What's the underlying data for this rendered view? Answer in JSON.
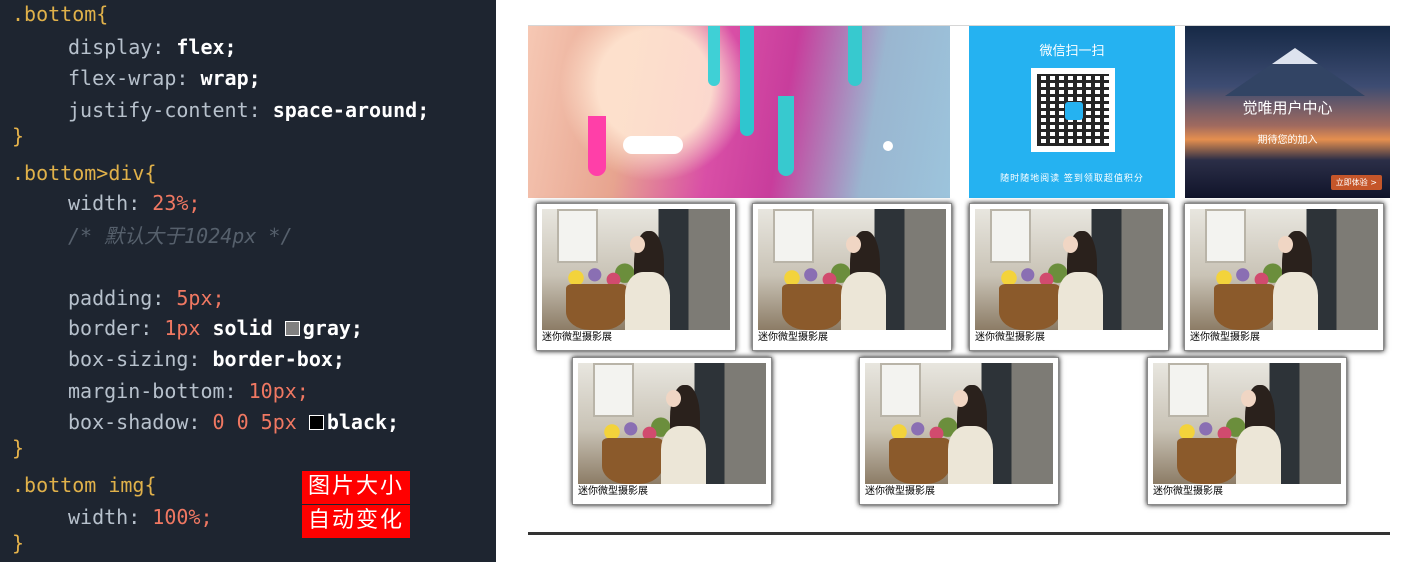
{
  "editor": {
    "lines": [
      ".bottom{",
      "display: flex;",
      "flex-wrap: wrap;",
      "justify-content: space-around;",
      "}",
      ".bottom>div{",
      "width: 23%;",
      "/* 默认大于1024px */",
      "",
      "padding: 5px;",
      "border: 1px solid ",
      "gray;",
      "box-sizing: border-box;",
      "margin-bottom: 10px;",
      "box-shadow: 0 0 5px ",
      "black;",
      "}",
      ".bottom img{",
      "width: 100%;",
      "}"
    ],
    "tokens": {
      "bottom_sel": ".bottom{",
      "display_prop": "display: ",
      "display_val": "flex;",
      "wrap_prop": "flex-wrap: ",
      "wrap_val": "wrap;",
      "justify_prop": "justify-content: ",
      "justify_val": "space-around;",
      "close": "}",
      "div_sel": ".bottom>div{",
      "width_prop": "width: ",
      "width_val": "23%;",
      "comment": "/* 默认大于1024px */",
      "padding_prop": "padding: ",
      "padding_val": "5px;",
      "border_prop": "border: ",
      "border_num": "1px",
      "border_kw": " solid ",
      "border_color": "gray;",
      "boxsizing_prop": "box-sizing: ",
      "boxsizing_val": "border-box;",
      "margin_prop": "margin-bottom: ",
      "margin_val": "10px;",
      "shadow_prop": "box-shadow: ",
      "shadow_nums": "0 0 5px",
      "shadow_color": "black;",
      "img_sel": ".bottom img{",
      "img_width_prop": "width: ",
      "img_width_val": "100%;"
    },
    "swatch_gray": "#808080",
    "swatch_black": "#000000"
  },
  "annotation": {
    "line1": "图片大小",
    "line2": "自动变化"
  },
  "preview": {
    "qr_panel": {
      "title": "微信扫一扫",
      "footer": "随时随地阅读  签到领取超值积分"
    },
    "user_panel": {
      "title": "觉唯用户中心",
      "subtitle": "期待您的加入",
      "button": "立即体验 >"
    },
    "cards": [
      {
        "caption": "迷你微型摄影展"
      },
      {
        "caption": "迷你微型摄影展"
      },
      {
        "caption": "迷你微型摄影展"
      },
      {
        "caption": "迷你微型摄影展"
      },
      {
        "caption": "迷你微型摄影展"
      },
      {
        "caption": "迷你微型摄影展"
      },
      {
        "caption": "迷你微型摄影展"
      }
    ]
  }
}
